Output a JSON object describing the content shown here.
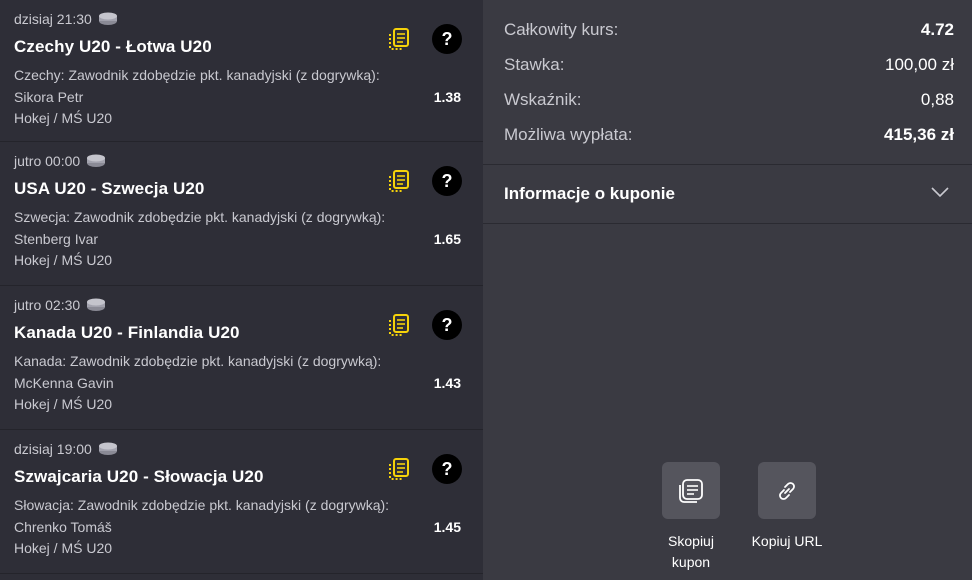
{
  "events": [
    {
      "time": "dzisiaj 21:30",
      "title": "Czechy U20 - Łotwa U20",
      "market": "Czechy: Zawodnik zdobędzie pkt. kanadyjski (z dogrywką):",
      "player": "Sikora Petr",
      "odds": "1.38",
      "league": "Hokej / MŚ U20"
    },
    {
      "time": "jutro 00:00",
      "title": "USA U20 - Szwecja U20",
      "market": "Szwecja: Zawodnik zdobędzie pkt. kanadyjski (z dogrywką):",
      "player": "Stenberg Ivar",
      "odds": "1.65",
      "league": "Hokej / MŚ U20"
    },
    {
      "time": "jutro 02:30",
      "title": "Kanada U20 - Finlandia U20",
      "market": "Kanada: Zawodnik zdobędzie pkt. kanadyjski (z dogrywką):",
      "player": "McKenna Gavin",
      "odds": "1.43",
      "league": "Hokej / MŚ U20"
    },
    {
      "time": "dzisiaj 19:00",
      "title": "Szwajcaria U20 - Słowacja U20",
      "market": "Słowacja: Zawodnik zdobędzie pkt. kanadyjski (z dogrywką):",
      "player": "Chrenko Tomáš",
      "odds": "1.45",
      "league": "Hokej / MŚ U20"
    }
  ],
  "help_glyph": "?",
  "summary": {
    "total_odds_label": "Całkowity kurs:",
    "total_odds_value": "4.72",
    "stake_label": "Stawka:",
    "stake_value": "100,00 zł",
    "indicator_label": "Wskaźnik:",
    "indicator_value": "0,88",
    "payout_label": "Możliwa wypłata:",
    "payout_value": "415,36 zł"
  },
  "info": {
    "label": "Informacje o kuponie"
  },
  "actions": {
    "copy_coupon_label": "Skopiuj kupon",
    "copy_url_label": "Kopiuj URL"
  },
  "icons": {
    "sport": "ice-hockey-puck-icon",
    "betbuilder": "copy-yellow-icon",
    "help": "question-icon",
    "chevron": "chevron-down-icon",
    "copy_coupon": "coupon-copy-icon",
    "copy_url": "link-icon"
  },
  "colors": {
    "left_bg": "#2e2e37",
    "right_bg": "#3a3a42",
    "accent_yellow": "#f5d20a",
    "button_bg": "#55555d"
  }
}
